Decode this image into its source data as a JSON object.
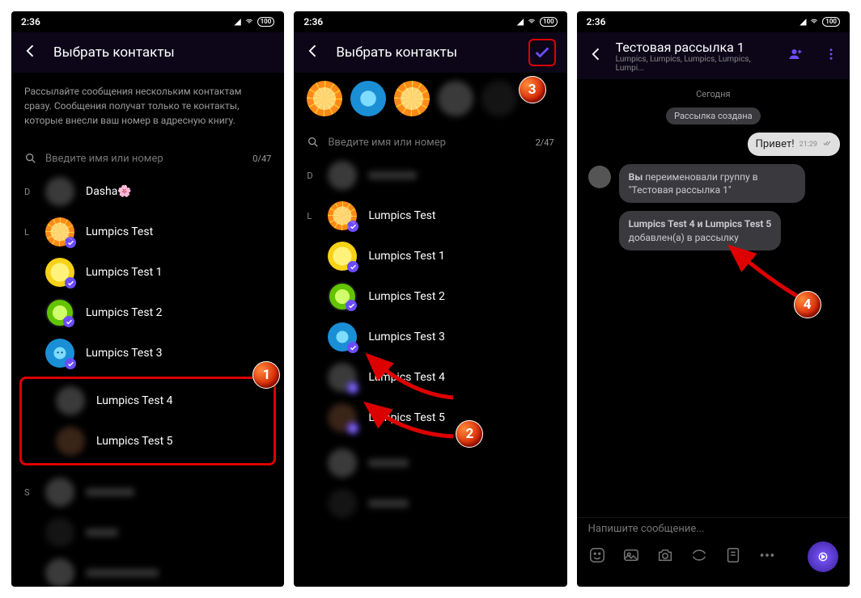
{
  "status": {
    "time": "2:36",
    "battery": "100"
  },
  "screen1": {
    "title": "Выбрать контакты",
    "info": "Рассылайте сообщения нескольким контактам сразу. Сообщения получат только те контакты, которые внесли ваш номер в адресную книгу.",
    "search_placeholder": "Введите имя или номер",
    "counter": "0/47",
    "letters": {
      "d": "D",
      "l": "L",
      "s": "S"
    },
    "contacts": {
      "dasha": "Dasha🌸",
      "c0": "Lumpics Test",
      "c1": "Lumpics Test 1",
      "c2": "Lumpics Test 2",
      "c3": "Lumpics Test 3",
      "c4": "Lumpics Test 4",
      "c5": "Lumpics Test 5"
    }
  },
  "screen2": {
    "title": "Выбрать контакты",
    "search_placeholder": "Введите имя или номер",
    "counter": "2/47",
    "letters": {
      "d": "D",
      "l": "L"
    },
    "contacts": {
      "c0": "Lumpics Test",
      "c1": "Lumpics Test 1",
      "c2": "Lumpics Test 2",
      "c3": "Lumpics Test 3",
      "c4": "Lumpics Test 4",
      "c5": "Lumpics Test 5"
    }
  },
  "screen3": {
    "title": "Тестовая рассылка 1",
    "subtitle": "Lumpics, Lumpics, Lumpics, Lumpics, Lumpi...",
    "day": "Сегодня",
    "created": "Рассылка создана",
    "msg_text": "Привет!",
    "msg_time": "21:29",
    "sys1_a": "Вы ",
    "sys1_b": "переименовали группу в \"Тестовая рассылка 1\"",
    "sys2_a": "Lumpics Test 4 и Lumpics Test 5",
    "sys2_b": "добавлен(а) в рассылку",
    "compose_placeholder": "Напишите сообщение..."
  },
  "badges": {
    "b1": "1",
    "b2": "2",
    "b3": "3",
    "b4": "4"
  }
}
